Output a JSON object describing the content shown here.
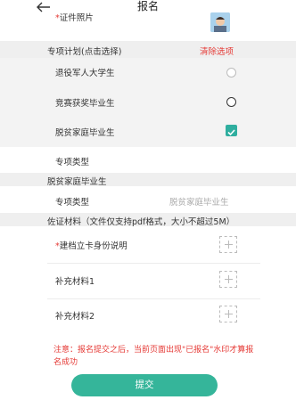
{
  "header": {
    "title": "报名"
  },
  "photo_row": {
    "required_mark": "*",
    "label": "证件照片"
  },
  "special_program": {
    "title": "专项计划(点击选择)",
    "clear_label": "清除选项",
    "options": [
      {
        "label": "退役军人大学生",
        "state": "unselected"
      },
      {
        "label": "竞赛获奖毕业生",
        "state": "unselected"
      },
      {
        "label": "脱贫家庭毕业生",
        "state": "selected"
      }
    ],
    "type_label": "专项类型"
  },
  "poverty_section": {
    "title": "脱贫家庭毕业生",
    "type_label": "专项类型",
    "type_value": "脱贫家庭毕业生"
  },
  "evidence": {
    "title": "佐证材料（文件仅支持pdf格式，大小不超过5M）",
    "items": [
      {
        "required_mark": "*",
        "label": "建档立卡身份说明"
      },
      {
        "required_mark": "",
        "label": "补充材料1"
      },
      {
        "required_mark": "",
        "label": "补充材料2"
      }
    ]
  },
  "notice": "注意：报名提交之后，当前页面出现\"已报名\"水印才算报名成功",
  "submit_label": "提交",
  "colors": {
    "accent": "#35b59a",
    "danger": "#e53935",
    "band": "#efefef"
  }
}
